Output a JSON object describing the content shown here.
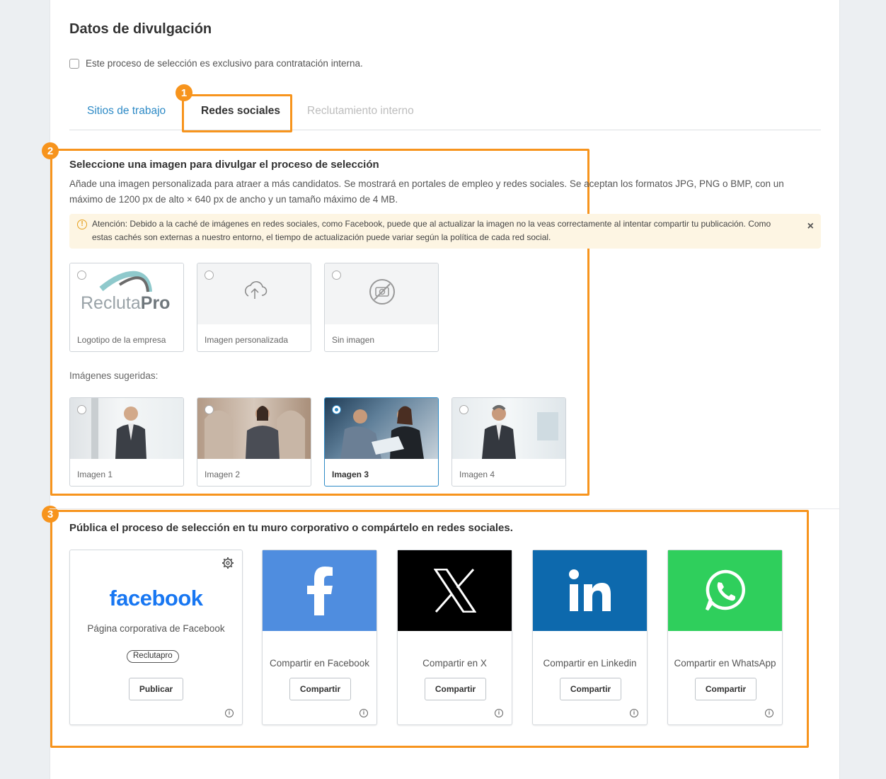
{
  "page": {
    "title": "Datos de divulgación",
    "internal_checkbox_label": "Este proceso de selección es exclusivo para contratación interna."
  },
  "tabs": [
    {
      "label": "Sitios de trabajo",
      "state": "link"
    },
    {
      "label": "Redes sociales",
      "state": "active"
    },
    {
      "label": "Reclutamiento interno",
      "state": "disabled"
    }
  ],
  "markers": [
    "1",
    "2",
    "3"
  ],
  "image_section": {
    "heading": "Seleccione una imagen para divulgar el proceso de selección",
    "description": "Añade una imagen personalizada para atraer a más candidatos. Se mostrará en portales de empleo y redes sociales. Se aceptan los formatos JPG, PNG o BMP, con un máximo de 1200 px de alto × 640 px de ancho y un tamaño máximo de 4 MB.",
    "alert_text": "Atención: Debido a la caché de imágenes en redes sociales, como Facebook, puede que al actualizar la imagen no la veas correctamente al intentar compartir tu publicación. Como estas cachés son externas a nuestro entorno, el tiempo de actualización puede variar según la política de cada red social.",
    "alert_close": "×",
    "options": [
      {
        "label": "Logotipo de la empresa",
        "logo_text_a": "Recluta",
        "logo_text_b": "Pro"
      },
      {
        "label": "Imagen personalizada",
        "icon": "upload-cloud-icon"
      },
      {
        "label": "Sin imagen",
        "icon": "no-camera-icon"
      }
    ],
    "suggested_label": "Imágenes sugeridas:",
    "suggested": [
      {
        "label": "Imagen 1",
        "selected": false
      },
      {
        "label": "Imagen 2",
        "selected": false
      },
      {
        "label": "Imagen 3",
        "selected": true
      },
      {
        "label": "Imagen 4",
        "selected": false
      }
    ]
  },
  "share_section": {
    "heading": "Pública el proceso de selección en tu muro corporativo o compártelo en redes sociales.",
    "corporate": {
      "logo_text": "facebook",
      "label": "Página corporativa de Facebook",
      "badge": "Reclutapro",
      "button": "Publicar"
    },
    "networks": [
      {
        "label": "Compartir en Facebook",
        "button": "Compartir",
        "color": "#4f8ddf",
        "icon": "facebook-icon"
      },
      {
        "label": "Compartir en X",
        "button": "Compartir",
        "color": "#000000",
        "icon": "x-icon"
      },
      {
        "label": "Compartir en Linkedin",
        "button": "Compartir",
        "color": "#0d69ad",
        "icon": "linkedin-icon"
      },
      {
        "label": "Compartir en WhatsApp",
        "button": "Compartir",
        "color": "#2fcf5c",
        "icon": "whatsapp-icon"
      }
    ]
  },
  "colors": {
    "accent": "#f7941d",
    "link": "#2d8ac6",
    "facebook_brand": "#1877f2"
  }
}
